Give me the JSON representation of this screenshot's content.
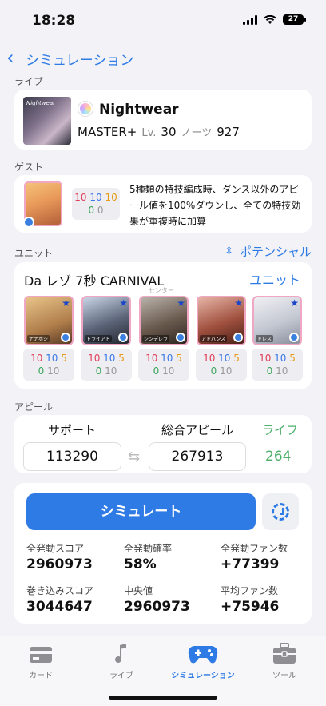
{
  "status": {
    "time": "18:28",
    "battery": "27"
  },
  "nav": {
    "back_label": "シミュレーション"
  },
  "live": {
    "section_label": "ライブ",
    "art_label": "Nightwear",
    "song_name": "Nightwear",
    "difficulty": "MASTER+",
    "level_label": "Lv.",
    "level": "30",
    "notes_label": "ノーツ",
    "notes": "927"
  },
  "guest": {
    "section_label": "ゲスト",
    "stats_row1": [
      "10",
      "10",
      "10"
    ],
    "stats_row2": [
      "0",
      "0"
    ],
    "description": "5種類の特技編成時、ダンス以外のアピール値を100%ダウンし、全ての特技効果が重複時に加算"
  },
  "unit": {
    "section_label": "ユニット",
    "potential_label": "ポテンシャル",
    "name": "Da レゾ 7秒 CARNIVAL",
    "unit_link": "ユニット",
    "center_label": "センター",
    "idols": [
      {
        "tag": "ナナホシ",
        "row1": [
          "10",
          "10",
          "5"
        ],
        "row2": [
          "0",
          "10"
        ]
      },
      {
        "tag": "トライアド",
        "row1": [
          "10",
          "10",
          "5"
        ],
        "row2": [
          "0",
          "10"
        ]
      },
      {
        "tag": "シンデレラ",
        "row1": [
          "10",
          "10",
          "5"
        ],
        "row2": [
          "0",
          "10"
        ]
      },
      {
        "tag": "アドバンス",
        "row1": [
          "10",
          "10",
          "5"
        ],
        "row2": [
          "0",
          "10"
        ]
      },
      {
        "tag": "ドレス",
        "row1": [
          "10",
          "10",
          "5"
        ],
        "row2": [
          "0",
          "10"
        ]
      }
    ]
  },
  "appeal": {
    "section_label": "アピール",
    "support_label": "サポート",
    "support_value": "113290",
    "total_label": "総合アピール",
    "total_value": "267913",
    "life_label": "ライフ",
    "life_value": "264"
  },
  "simulate": {
    "button_label": "シミュレート",
    "results": [
      {
        "label": "全発動スコア",
        "value": "2960973"
      },
      {
        "label": "全発動確率",
        "value": "58%"
      },
      {
        "label": "全発動ファン数",
        "value": "+77399"
      },
      {
        "label": "巻き込みスコア",
        "value": "3044647"
      },
      {
        "label": "中央値",
        "value": "2960973"
      },
      {
        "label": "平均ファン数",
        "value": "+75946"
      }
    ]
  },
  "tabs": [
    {
      "label": "カード",
      "icon": "card-icon",
      "active": false
    },
    {
      "label": "ライブ",
      "icon": "music-note-icon",
      "active": false
    },
    {
      "label": "シミュレーション",
      "icon": "gamepad-icon",
      "active": true
    },
    {
      "label": "ツール",
      "icon": "toolbox-icon",
      "active": false
    }
  ],
  "colors": {
    "accent": "#2f7be5",
    "life": "#4caf6a",
    "vocal": "#e0405a",
    "dance": "#3a78e8",
    "visual": "#e69a1a"
  }
}
